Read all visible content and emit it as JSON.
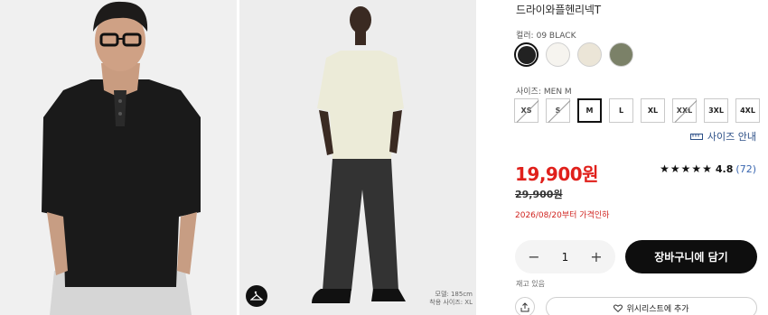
{
  "gallery": {
    "model_height": "모델: 185cm",
    "model_size": "착용 사이즈: XL",
    "fit_icon": "hanger-icon"
  },
  "product": {
    "title": "드라이와플헨리넥T"
  },
  "color": {
    "label": "컬러:",
    "value": "09 BLACK",
    "swatches": [
      {
        "name": "black",
        "hex": "#222222",
        "selected": true
      },
      {
        "name": "off-white",
        "hex": "#f6f4ef",
        "selected": false
      },
      {
        "name": "natural",
        "hex": "#ebe5d7",
        "selected": false
      },
      {
        "name": "olive",
        "hex": "#7b8168",
        "selected": false
      }
    ]
  },
  "size": {
    "label": "사이즈:",
    "value": "MEN M",
    "options": [
      "XS",
      "S",
      "M",
      "L",
      "XL",
      "XXL",
      "3XL",
      "4XL"
    ],
    "selected": "M",
    "unavailable": [
      "XS",
      "S",
      "XXL"
    ],
    "guide_label": "사이즈 안내",
    "guide_icon": "ruler-icon"
  },
  "price": {
    "current": "19,900원",
    "original": "29,900원",
    "note": "2026/08/20부터 가격인하",
    "accent_color": "#e0201b"
  },
  "rating": {
    "stars": "★★★★★",
    "score": "4.8",
    "count": "(72)"
  },
  "purchase": {
    "minus": "−",
    "quantity": "1",
    "plus": "+",
    "cart_label": "장바구니에 담기",
    "stock": "재고 있음",
    "share_icon": "share-icon",
    "wishlist_label": "위시리스트에 추가",
    "wishlist_icon": "heart-icon"
  }
}
